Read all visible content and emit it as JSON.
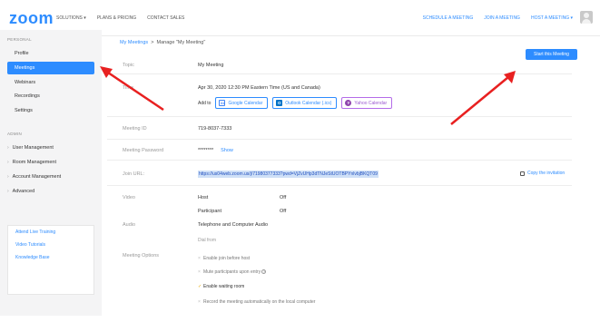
{
  "colors": {
    "brand": "#2d8cff",
    "arrow": "#e82020",
    "sidebar_bg": "#f4f4f5"
  },
  "topbar": {
    "logo": "zoom",
    "left_links": [
      {
        "label": "SOLUTIONS",
        "has_caret": true
      },
      {
        "label": "PLANS & PRICING",
        "has_caret": false
      },
      {
        "label": "CONTACT SALES",
        "has_caret": false
      }
    ],
    "right_links": [
      {
        "label": "SCHEDULE A MEETING",
        "has_caret": false
      },
      {
        "label": "JOIN A MEETING",
        "has_caret": false
      },
      {
        "label": "HOST A MEETING",
        "has_caret": true
      }
    ],
    "avatar_icon": "user-avatar-icon"
  },
  "sidebar": {
    "personal_header": "PERSONAL",
    "personal_items": [
      "Profile",
      "Meetings",
      "Webinars",
      "Recordings",
      "Settings"
    ],
    "active_item": "Meetings",
    "admin_header": "ADMIN",
    "admin_items": [
      "User Management",
      "Room Management",
      "Account Management",
      "Advanced"
    ],
    "links": [
      "Attend Live Training",
      "Video Tutorials",
      "Knowledge Base"
    ]
  },
  "main": {
    "breadcrumb": {
      "parent": "My Meetings",
      "separator": ">",
      "current": "Manage \"My Meeting\""
    },
    "start_button": "Start this Meeting",
    "topic": {
      "label": "Topic",
      "value": "My Meeting"
    },
    "time": {
      "label": "Time",
      "value": "Apr 30, 2020 12:30 PM Eastern Time (US and Canada)",
      "add_to": "Add to",
      "calendars": [
        "Google Calendar",
        "Outlook Calendar (.ics)",
        "Yahoo Calendar"
      ]
    },
    "meeting_id": {
      "label": "Meeting ID",
      "value": "719-8037-7333"
    },
    "password": {
      "label": "Meeting Password",
      "value": "********",
      "show": "Show"
    },
    "join_url": {
      "label": "Join URL:",
      "value": "https://us04web.zoom.us/j/71980377333?pwd=VjZvUHp3dTNJeStUOTBPYnlvbjBKQT09",
      "copy": "Copy the invitation"
    },
    "video": {
      "label": "Video",
      "host_label": "Host",
      "host_value": "Off",
      "participant_label": "Participant",
      "participant_value": "Off"
    },
    "audio": {
      "label": "Audio",
      "value": "Telephone and Computer Audio",
      "dial_from": "Dial from"
    },
    "options": {
      "label": "Meeting Options",
      "items": [
        {
          "text": "Enable join before host",
          "enabled": false
        },
        {
          "text": "Mute participants upon entry",
          "enabled": false
        },
        {
          "text": "Enable waiting room",
          "enabled": true
        },
        {
          "text": "Record the meeting automatically on the local computer",
          "enabled": false
        }
      ]
    }
  }
}
